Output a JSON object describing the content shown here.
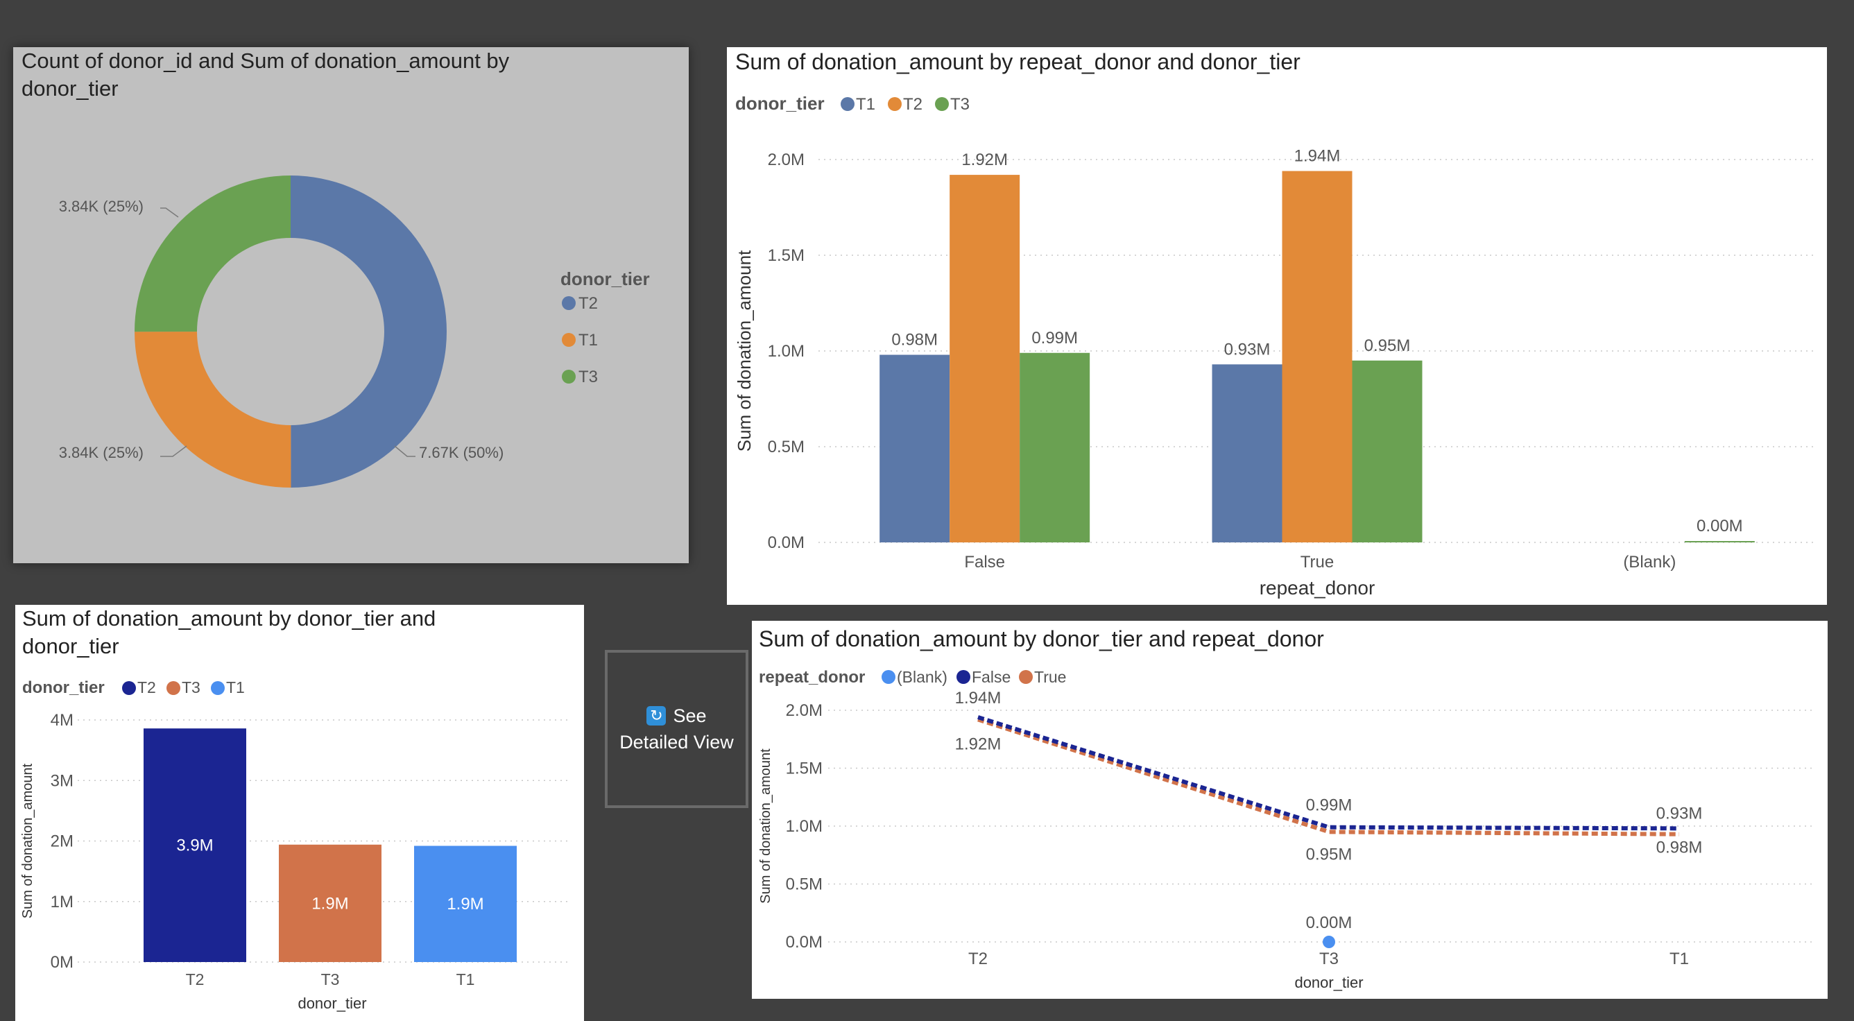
{
  "colors": {
    "t1_blue": "#5b78a8",
    "t2_orange": "#e28a38",
    "t3_green": "#6aa152",
    "navy": "#1b2592",
    "coral": "#d1734a",
    "bright_blue": "#4a8ff0",
    "blank_blue": "#4a8ff0",
    "panel_gray": "#c0c0c0",
    "background": "#404040"
  },
  "detail_button": {
    "line1": "See",
    "line2": "Detailed View",
    "icon": "refresh-icon"
  },
  "chart_data": [
    {
      "id": "donut",
      "type": "pie",
      "title": "Count of donor_id and Sum of donation_amount by donor_tier",
      "legend_title": "donor_tier",
      "legend_placement": "right",
      "slices": [
        {
          "name": "T2",
          "value": 7670,
          "label": "7.67K (50%)",
          "color": "#5b78a8"
        },
        {
          "name": "T1",
          "value": 3840,
          "label": "3.84K (25%)",
          "color": "#e28a38"
        },
        {
          "name": "T3",
          "value": 3840,
          "label": "3.84K (25%)",
          "color": "#6aa152"
        }
      ]
    },
    {
      "id": "bars",
      "type": "bar",
      "title": "Sum of donation_amount by repeat_donor and donor_tier",
      "legend_title": "donor_tier",
      "legend_placement": "top-left",
      "xlabel": "repeat_donor",
      "ylabel": "Sum of donation_amount",
      "ylim": [
        0,
        2.0
      ],
      "yticks": [
        0,
        0.5,
        1.0,
        1.5,
        2.0
      ],
      "ytick_labels": [
        "0.0M",
        "0.5M",
        "1.0M",
        "1.5M",
        "2.0M"
      ],
      "grid": true,
      "categories": [
        "False",
        "True",
        "(Blank)"
      ],
      "series": [
        {
          "name": "T1",
          "color": "#5b78a8",
          "values": [
            0.98,
            0.93,
            null
          ],
          "labels": [
            "0.98M",
            "0.93M",
            ""
          ]
        },
        {
          "name": "T2",
          "color": "#e28a38",
          "values": [
            1.92,
            1.94,
            null
          ],
          "labels": [
            "1.92M",
            "1.94M",
            ""
          ]
        },
        {
          "name": "T3",
          "color": "#6aa152",
          "values": [
            0.99,
            0.95,
            0.0
          ],
          "labels": [
            "0.99M",
            "0.95M",
            "0.00M"
          ]
        }
      ]
    },
    {
      "id": "tierbars",
      "type": "bar",
      "title": "Sum of donation_amount by donor_tier and donor_tier",
      "legend_title": "donor_tier",
      "legend_placement": "top-left",
      "xlabel": "donor_tier",
      "ylabel": "Sum of donation_amount",
      "ylim": [
        0,
        4
      ],
      "yticks": [
        0,
        1,
        2,
        3,
        4
      ],
      "ytick_labels": [
        "0M",
        "1M",
        "2M",
        "3M",
        "4M"
      ],
      "grid": true,
      "categories": [
        "T2",
        "T3",
        "T1"
      ],
      "values": [
        3.86,
        1.94,
        1.92
      ],
      "labels": [
        "3.9M",
        "1.9M",
        "1.9M"
      ],
      "colors": [
        "#1b2592",
        "#d1734a",
        "#4a8ff0"
      ],
      "legend": [
        {
          "name": "T2",
          "color": "#1b2592"
        },
        {
          "name": "T3",
          "color": "#d1734a"
        },
        {
          "name": "T1",
          "color": "#4a8ff0"
        }
      ]
    },
    {
      "id": "lines",
      "type": "line",
      "title": "Sum of donation_amount by donor_tier and repeat_donor",
      "legend_title": "repeat_donor",
      "legend_placement": "top-left",
      "xlabel": "donor_tier",
      "ylabel": "Sum of donation_amount",
      "ylim": [
        0,
        2.0
      ],
      "yticks": [
        0,
        0.5,
        1.0,
        1.5,
        2.0
      ],
      "ytick_labels": [
        "0.0M",
        "0.5M",
        "1.0M",
        "1.5M",
        "2.0M"
      ],
      "grid": true,
      "categories": [
        "T2",
        "T3",
        "T1"
      ],
      "series": [
        {
          "name": "(Blank)",
          "color": "#4a8ff0",
          "values": [
            null,
            0.0,
            null
          ],
          "labels": [
            "",
            "0.00M",
            ""
          ]
        },
        {
          "name": "False",
          "color": "#1b2592",
          "values": [
            1.94,
            0.99,
            0.98
          ],
          "labels": [
            "1.94M",
            "0.99M",
            "0.98M"
          ]
        },
        {
          "name": "True",
          "color": "#d1734a",
          "values": [
            1.92,
            0.95,
            0.93
          ],
          "labels": [
            "1.92M",
            "0.95M",
            "0.93M"
          ]
        }
      ]
    }
  ]
}
